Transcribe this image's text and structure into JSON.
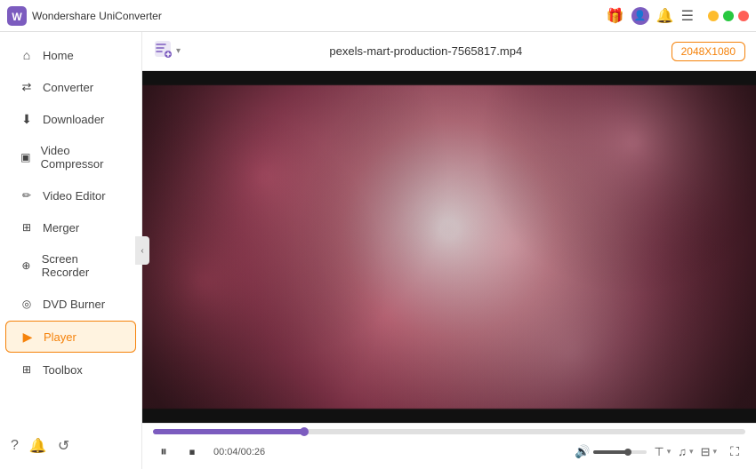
{
  "titlebar": {
    "app_name": "Wondershare UniConverter",
    "logo_text": "W"
  },
  "sidebar": {
    "items": [
      {
        "id": "home",
        "label": "Home",
        "icon": "⌂"
      },
      {
        "id": "converter",
        "label": "Converter",
        "icon": "↔"
      },
      {
        "id": "downloader",
        "label": "Downloader",
        "icon": "↓"
      },
      {
        "id": "video-compressor",
        "label": "Video Compressor",
        "icon": "⊡"
      },
      {
        "id": "video-editor",
        "label": "Video Editor",
        "icon": "✏"
      },
      {
        "id": "merger",
        "label": "Merger",
        "icon": "⊞"
      },
      {
        "id": "screen-recorder",
        "label": "Screen Recorder",
        "icon": "⊕"
      },
      {
        "id": "dvd-burner",
        "label": "DVD Burner",
        "icon": "◎"
      },
      {
        "id": "player",
        "label": "Player",
        "icon": "▶",
        "active": true
      },
      {
        "id": "toolbox",
        "label": "Toolbox",
        "icon": "⊞"
      }
    ],
    "bottom_icons": [
      "?",
      "🔔",
      "↺"
    ]
  },
  "player": {
    "filename": "pexels-mart-production-7565817.mp4",
    "resolution_badge": "2048X1080",
    "current_time": "00:04",
    "total_time": "00:26",
    "progress_percent": 25.6,
    "volume_percent": 65
  },
  "topbar": {
    "add_file_tooltip": "Add File"
  }
}
